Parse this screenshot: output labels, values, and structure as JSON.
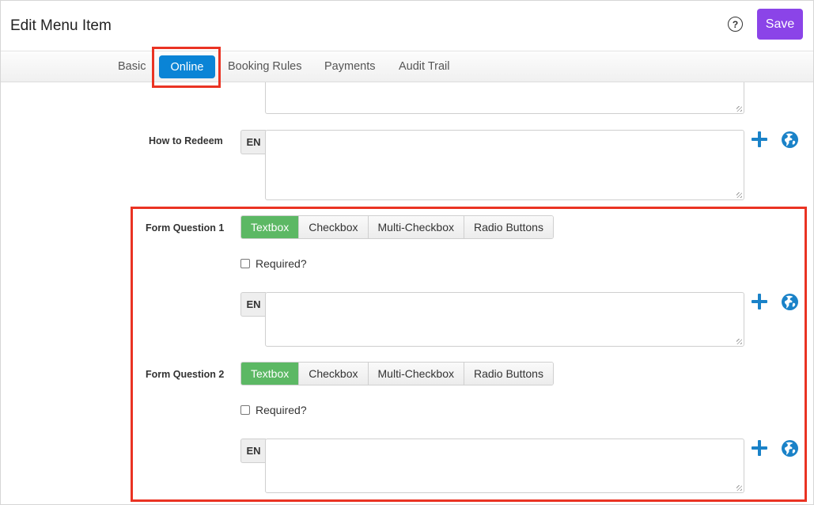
{
  "header": {
    "title": "Edit Menu Item",
    "help_icon": "question-circle-icon",
    "help_glyph": "?",
    "save_label": "Save"
  },
  "tabs": [
    {
      "label": "Basic",
      "active": false
    },
    {
      "label": "Online",
      "active": true
    },
    {
      "label": "Booking Rules",
      "active": false
    },
    {
      "label": "Payments",
      "active": false
    },
    {
      "label": "Audit Trail",
      "active": false
    }
  ],
  "colors": {
    "save_button": "#8b44e8",
    "active_tab": "#0a84d6",
    "active_toggle": "#5cb864",
    "action_icons": "#1a82c8",
    "highlight_box": "#ea3323"
  },
  "fields": {
    "how_to_redeem": {
      "label": "How to Redeem",
      "language": "EN",
      "value": ""
    },
    "form_questions": [
      {
        "label": "Form Question 1",
        "types": [
          "Textbox",
          "Checkbox",
          "Multi-Checkbox",
          "Radio Buttons"
        ],
        "selected_type": "Textbox",
        "required_label": "Required?",
        "required": false,
        "language": "EN",
        "value": ""
      },
      {
        "label": "Form Question 2",
        "types": [
          "Textbox",
          "Checkbox",
          "Multi-Checkbox",
          "Radio Buttons"
        ],
        "selected_type": "Textbox",
        "required_label": "Required?",
        "required": false,
        "language": "EN",
        "value": ""
      }
    ]
  },
  "icons": {
    "add": "plus-icon",
    "translate": "globe-icon"
  }
}
